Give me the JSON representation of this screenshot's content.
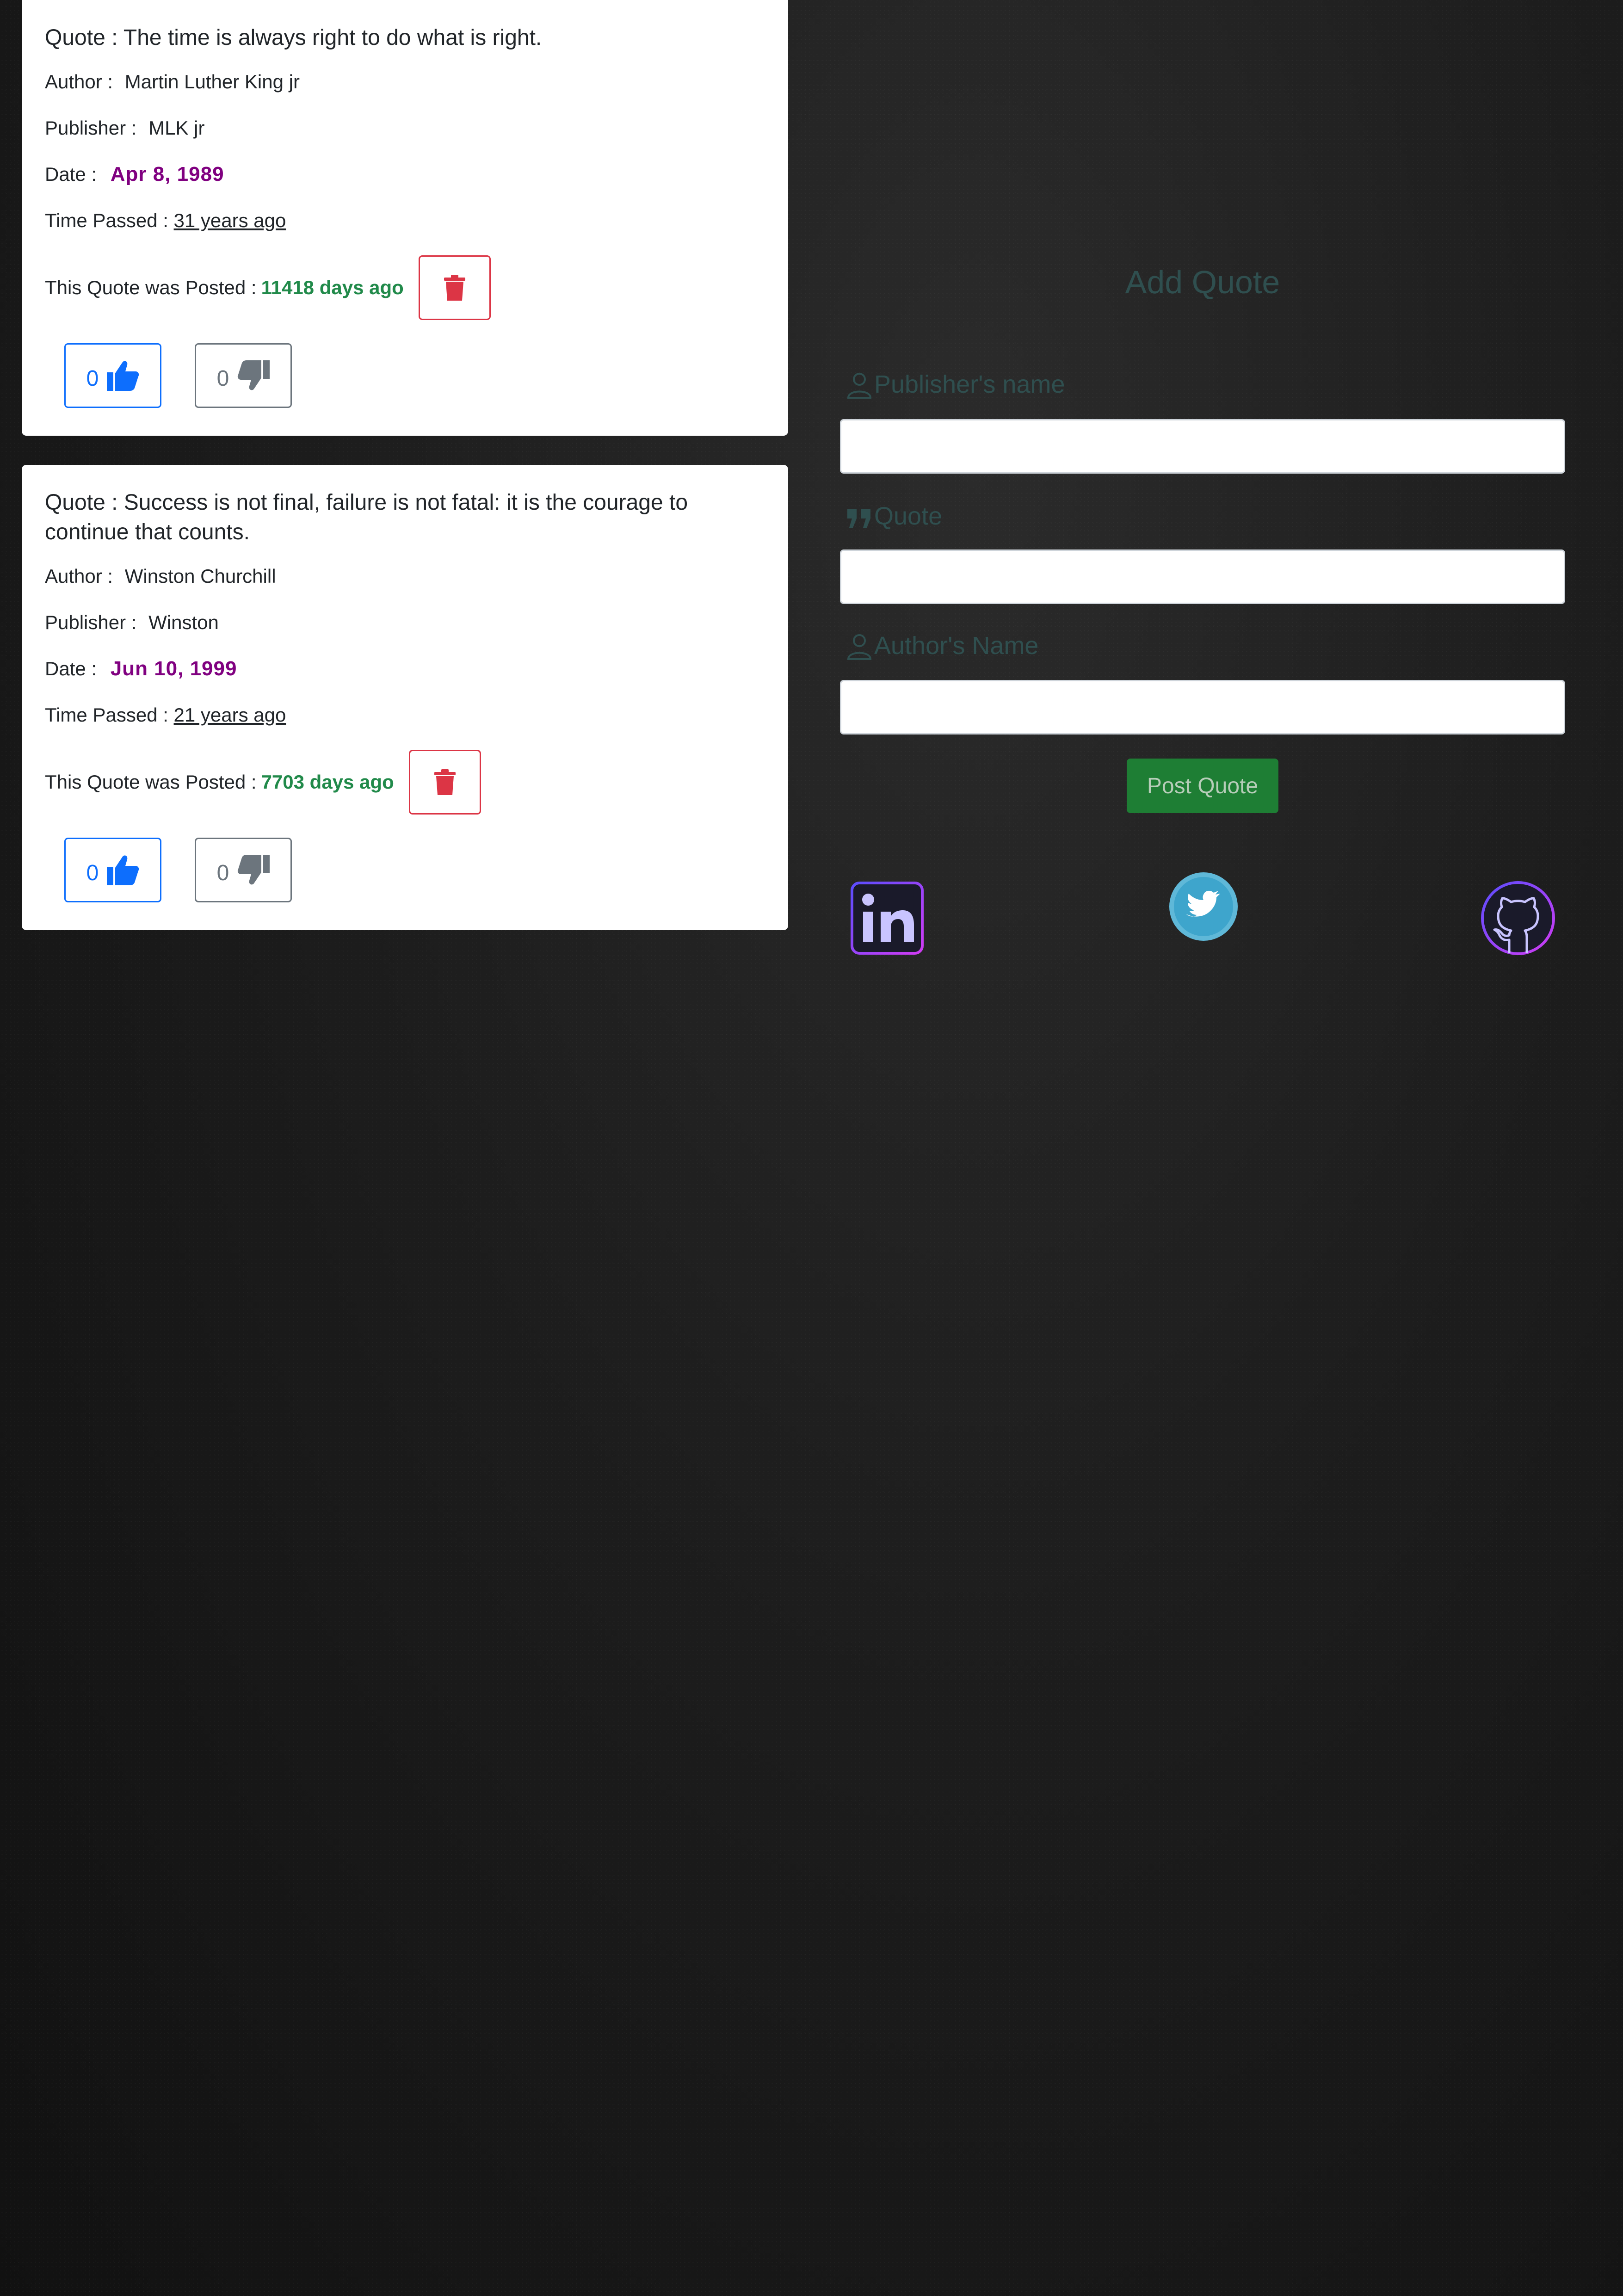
{
  "quotes": [
    {
      "quote_label": "Quote : ",
      "quote_text": "The time is always right to do what is right.",
      "author_label": "Author : ",
      "author": "Martin Luther King jr",
      "publisher_label": "Publisher : ",
      "publisher": "MLK jr",
      "date_label": "Date : ",
      "date": "Apr 8, 1989",
      "passed_label": "Time Passed : ",
      "passed": "31 years ago",
      "posted_label": "This Quote was Posted : ",
      "posted": "11418 days ago",
      "likes": "0",
      "dislikes": "0"
    },
    {
      "quote_label": "Quote : ",
      "quote_text": "Success is not final, failure is not fatal: it is the courage to continue that counts.",
      "author_label": "Author : ",
      "author": "Winston Churchill",
      "publisher_label": "Publisher : ",
      "publisher": "Winston",
      "date_label": "Date : ",
      "date": "Jun 10, 1999",
      "passed_label": "Time Passed : ",
      "passed": "21 years ago",
      "posted_label": "This Quote was Posted : ",
      "posted": "7703 days ago",
      "likes": "0",
      "dislikes": "0"
    }
  ],
  "form": {
    "title": "Add Quote",
    "publisher_label": "Publisher's name",
    "quote_label": "Quote",
    "author_label": "Author's Name",
    "publisher_value": "",
    "quote_value": "",
    "author_value": "",
    "submit_label": "Post Quote"
  },
  "social": {
    "linkedin_icon": "linkedin-icon",
    "twitter_icon": "twitter-icon",
    "github_icon": "github-icon"
  },
  "colors": {
    "like": "#0d6efd",
    "dislike": "#6c757d",
    "delete": "#dc3545",
    "date": "#800080",
    "posted": "#218a4a",
    "form_text": "#2f4f4f",
    "submit": "#1e7e34"
  }
}
